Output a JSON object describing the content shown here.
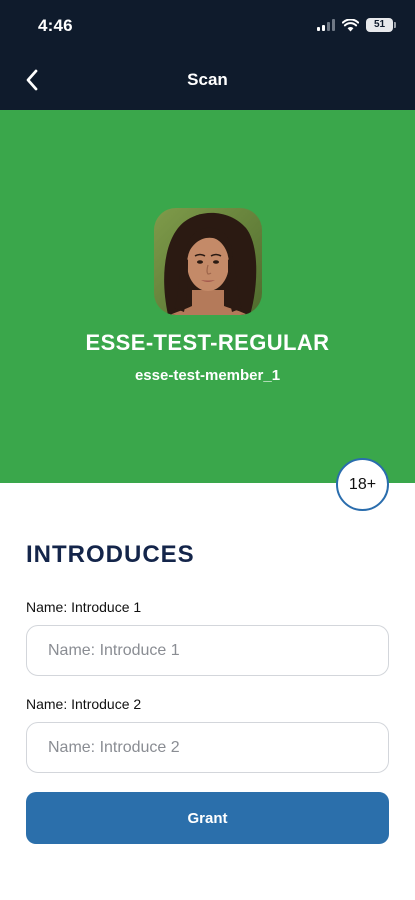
{
  "status_bar": {
    "time": "4:46",
    "battery": "51",
    "icons": [
      "cellular-signal-icon",
      "wifi-icon",
      "battery-icon"
    ]
  },
  "nav": {
    "title": "Scan",
    "back_icon": "chevron-left-icon"
  },
  "member": {
    "name": "ESSE-TEST-REGULAR",
    "id": "esse-test-member_1",
    "age_badge": "18+",
    "header_color": "#3aa74b"
  },
  "introduces": {
    "title": "INTRODUCES",
    "fields": [
      {
        "label": "Name: Introduce 1",
        "placeholder": "Name: Introduce 1",
        "value": ""
      },
      {
        "label": "Name: Introduce 2",
        "placeholder": "Name: Introduce 2",
        "value": ""
      }
    ],
    "grant_label": "Grant"
  },
  "colors": {
    "topbar": "#0f1b2c",
    "accent_button": "#2b6fab",
    "section_title": "#14254a"
  }
}
